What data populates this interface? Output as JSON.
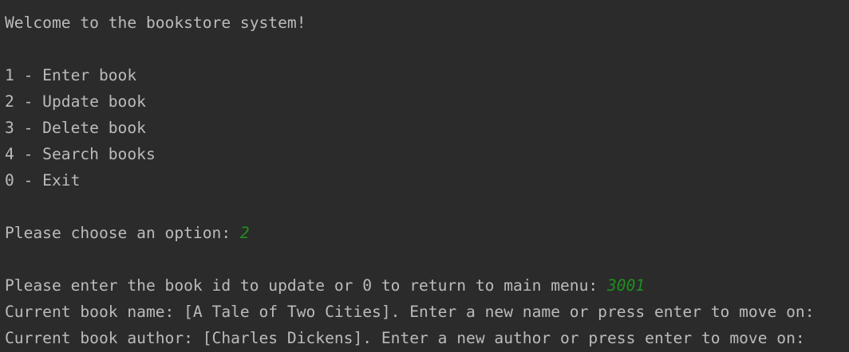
{
  "theme": {
    "background": "#2b2b2b",
    "text": "#bbbbbb",
    "user_input": "#1f8f1f"
  },
  "console": {
    "welcome": "Welcome to the bookstore system!",
    "menu": [
      "1 - Enter book",
      "2 - Update book",
      "3 - Delete book",
      "4 - Search books",
      "0 - Exit"
    ],
    "choose_prompt": "Please choose an option: ",
    "choose_input": "2",
    "book_id_prompt": "Please enter the book id to update or 0 to return to main menu: ",
    "book_id_input": "3001",
    "current_name_line": "Current book name: [A Tale of Two Cities]. Enter a new name or press enter to move on:",
    "current_author_line": "Current book author: [Charles Dickens]. Enter a new author or press enter to move on:"
  }
}
